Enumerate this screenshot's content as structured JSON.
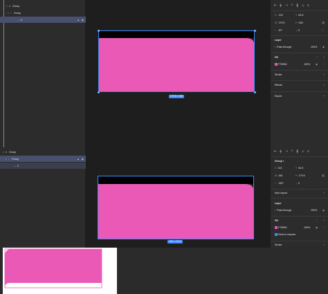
{
  "panel1": {
    "layers": [
      {
        "name": "Group",
        "indent": 0
      },
      {
        "name": "Group",
        "indent": 1
      },
      {
        "name": "3",
        "indent": 2,
        "selected": true
      }
    ],
    "align_icons": [
      "align-left-icon",
      "align-center-h-icon",
      "align-right-icon",
      "align-top-icon",
      "align-middle-v-icon",
      "align-bottom-icon",
      "distribute-icon"
    ],
    "transform": {
      "x_label": "X",
      "x": "-133",
      "y_label": "Y",
      "y": "64.5",
      "w_label": "W",
      "w": "179.5",
      "h_label": "H",
      "h": "446",
      "rot": "90°",
      "rad": "0"
    },
    "layer_section": "Layer",
    "blend": "Pass through",
    "opacity": "100%",
    "fill_section": "Fill",
    "fill_hex": "F759B4",
    "fill_opacity": "100%",
    "stroke_section": "Stroke",
    "effects_section": "Effects",
    "export_section": "Export",
    "size_badge": "179.5 × 446",
    "fill_color": "#EB59B7"
  },
  "panel2": {
    "layers": [
      {
        "name": "Group",
        "indent": 0
      },
      {
        "name": "Group",
        "indent": 1,
        "selected": true
      },
      {
        "name": "3",
        "indent": 2
      }
    ],
    "align_icons": [
      "align-left-icon",
      "align-center-h-icon",
      "align-right-icon",
      "align-top-icon",
      "align-middle-v-icon",
      "align-bottom-icon",
      "distribute-icon"
    ],
    "group_section": "Group",
    "transform": {
      "x_label": "X",
      "x": "313",
      "y_label": "Y",
      "y": "64.5",
      "w_label": "W",
      "w": "446",
      "h_label": "H",
      "h": "179.5",
      "rot": "180°",
      "rad": "0"
    },
    "autolayout_section": "Auto layout",
    "layer_section": "Layer",
    "blend": "Pass through",
    "opacity": "100%",
    "fill_section": "Fill",
    "fill_hex": "F759B4",
    "fill_opacity": "100%",
    "show_exports": "Show in exports",
    "stroke_section": "Stroke",
    "size_badge": "446 × 179.5",
    "fill_color": "#EB59B7"
  }
}
